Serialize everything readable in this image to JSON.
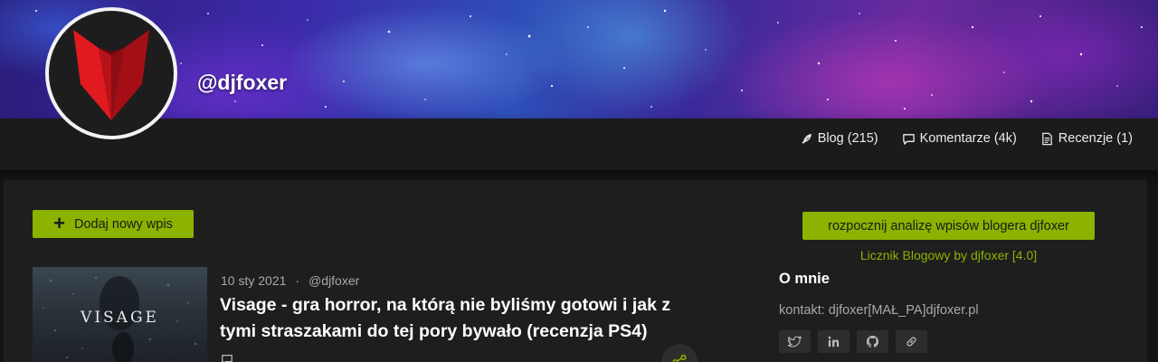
{
  "profile": {
    "username": "@djfoxer"
  },
  "nav": {
    "tabs": [
      {
        "label": "Blog (215)",
        "icon": "feather-icon"
      },
      {
        "label": "Komentarze (4k)",
        "icon": "comment-icon"
      },
      {
        "label": "Recenzje (1)",
        "icon": "document-icon"
      }
    ]
  },
  "actions": {
    "add_post_label": "Dodaj nowy wpis",
    "analyze_label": "rozpocznij analizę wpisów blogera djfoxer",
    "counter_link": "Licznik Blogowy by djfoxer [4.0]"
  },
  "post": {
    "thumbnail_text": "VISAGE",
    "date": "10 sty 2021",
    "separator": "·",
    "author": "@djfoxer",
    "title": "Visage - gra horror, na którą nie byliśmy gotowi i jak z tymi straszakami do tej pory bywało (recenzja PS4)"
  },
  "about": {
    "heading": "O mnie",
    "contact": "kontakt: djfoxer[MAŁ_PA]djfoxer.pl",
    "social": [
      "twitter-icon",
      "linkedin-icon",
      "github-icon",
      "link-icon"
    ]
  },
  "colors": {
    "accent": "#8bb300",
    "background": "#1e1e1e",
    "header": "#1b1b1b",
    "avatar_red": "#c8161b"
  }
}
